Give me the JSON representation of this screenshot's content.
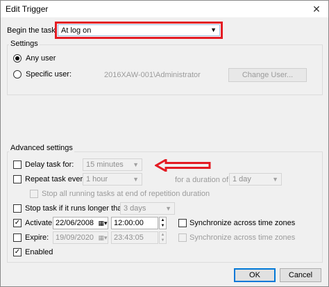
{
  "window": {
    "title": "Edit Trigger",
    "close_glyph": "✕"
  },
  "begin": {
    "label": "Begin the task:",
    "value": "At log on"
  },
  "settings": {
    "group_title": "Settings",
    "any_user": "Any user",
    "specific_user": "Specific user:",
    "user_value": "2016XAW-001\\Administrator",
    "change_user": "Change User..."
  },
  "advanced": {
    "group_title": "Advanced settings",
    "delay_label": "Delay task for:",
    "delay_value": "15 minutes",
    "repeat_label": "Repeat task every:",
    "repeat_value": "1 hour",
    "duration_label": "for a duration of:",
    "duration_value": "1 day",
    "stop_running_label": "Stop all running tasks at end of repetition duration",
    "stop_longer_label": "Stop task if it runs longer than:",
    "stop_longer_value": "3 days",
    "activate_label": "Activate:",
    "activate_date": "22/06/2008",
    "activate_time": "12:00:00",
    "expire_label": "Expire:",
    "expire_date": "19/09/2020",
    "expire_time": "23:43:05",
    "sync1": "Synchronize across time zones",
    "sync2": "Synchronize across time zones",
    "enabled_label": "Enabled"
  },
  "footer": {
    "ok": "OK",
    "cancel": "Cancel"
  },
  "annotation": {
    "arrow_color": "#e31b23"
  }
}
